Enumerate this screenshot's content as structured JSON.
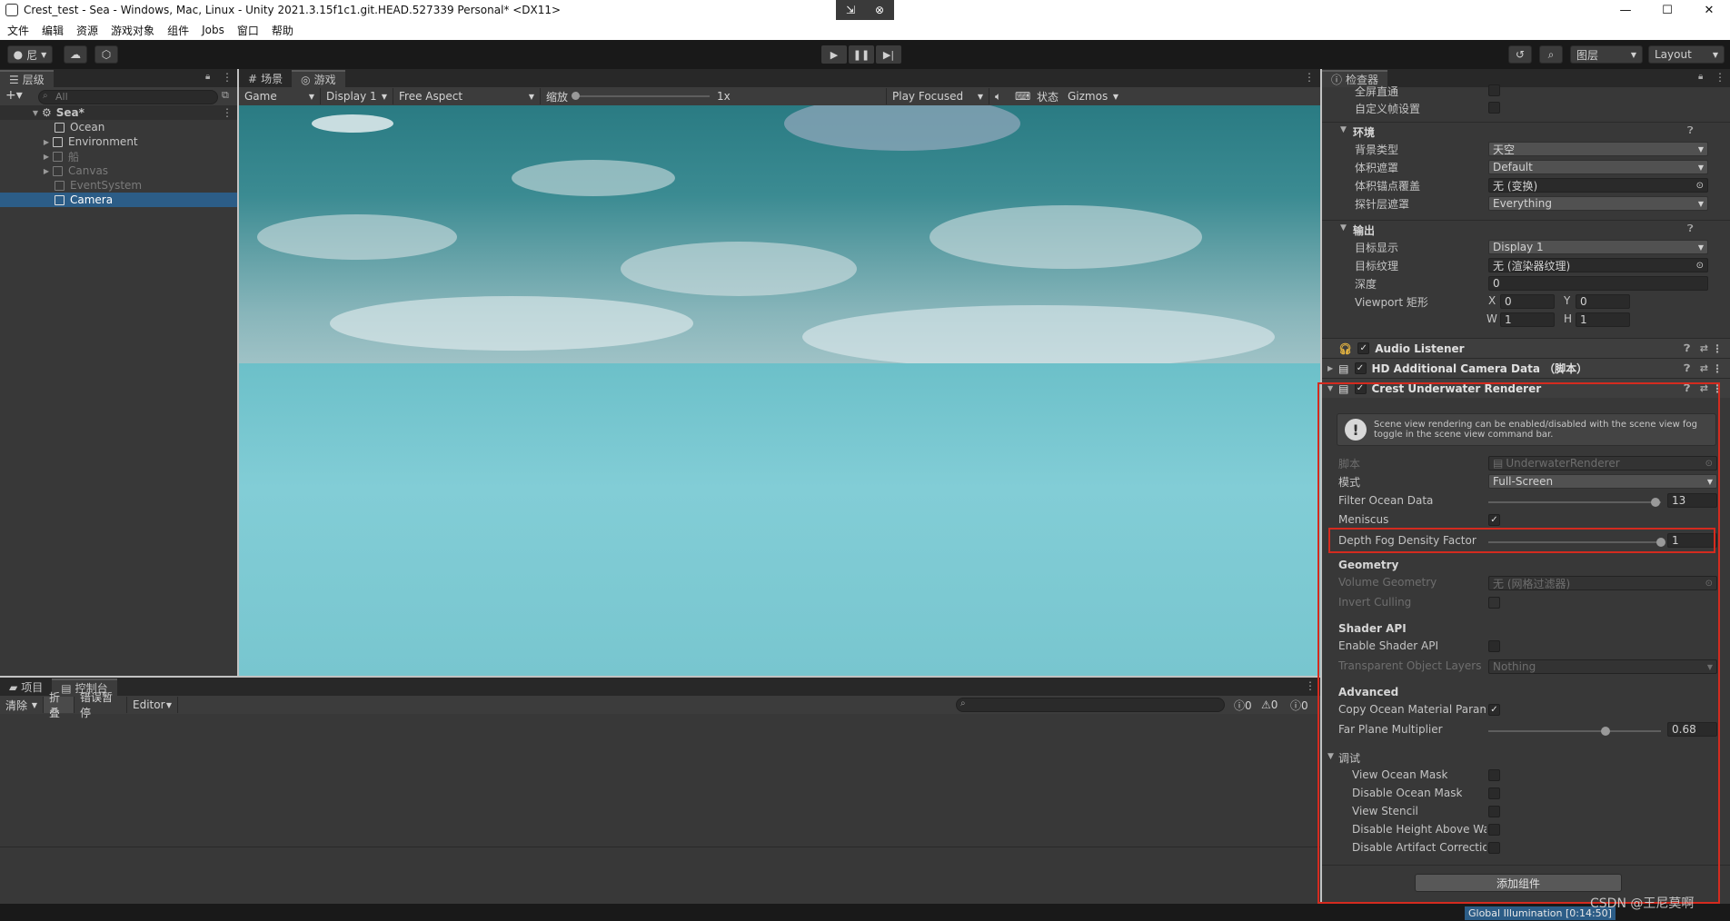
{
  "window": {
    "title": "Crest_test - Sea - Windows, Mac, Linux - Unity 2021.3.15f1c1.git.HEAD.527339 Personal* <DX11>",
    "minimize": "—",
    "maximize": "☐",
    "close": "✕"
  },
  "menu": [
    "文件",
    "编辑",
    "资源",
    "游戏对象",
    "组件",
    "Jobs",
    "窗口",
    "帮助"
  ],
  "toolbar": {
    "account": "尼",
    "layers": "图层",
    "layout": "Layout"
  },
  "hierarchy": {
    "tab": "层级",
    "search_placeholder": "All",
    "scene": "Sea*",
    "items": [
      {
        "label": "Ocean"
      },
      {
        "label": "Environment"
      },
      {
        "label": "船"
      },
      {
        "label": "Canvas"
      },
      {
        "label": "EventSystem"
      },
      {
        "label": "Camera"
      }
    ]
  },
  "game_view": {
    "tab_scene": "场景",
    "tab_game": "游戏",
    "mode": "Game",
    "display": "Display 1",
    "aspect": "Free Aspect",
    "scale_label": "缩放",
    "scale_value": "1x",
    "play_mode": "Play Focused",
    "stats": "状态",
    "gizmos": "Gizmos"
  },
  "console": {
    "tab_project": "项目",
    "tab_console": "控制台",
    "clear": "清除",
    "collapse": "折叠",
    "error_pause": "错误暂停",
    "editor": "Editor",
    "count_info": "0",
    "count_warn": "0",
    "count_error": "0"
  },
  "inspector": {
    "tab": "检查器",
    "top_rows": [
      {
        "label": "全屏直通"
      },
      {
        "label": "自定义帧设置"
      }
    ],
    "env_header": "环境",
    "env_rows": [
      {
        "label": "背景类型",
        "value": "天空"
      },
      {
        "label": "体积遮罩",
        "value": "Default"
      },
      {
        "label": "体积锚点覆盖",
        "value": "无 (变换)"
      },
      {
        "label": "探针层遮罩",
        "value": "Everything"
      }
    ],
    "output_header": "输出",
    "output_rows": [
      {
        "label": "目标显示",
        "value": "Display 1"
      },
      {
        "label": "目标纹理",
        "value": "无 (渲染器纹理)"
      },
      {
        "label": "深度",
        "value": "0"
      }
    ],
    "viewport_label": "Viewport 矩形",
    "viewport": {
      "x_label": "X",
      "x": "0",
      "y_label": "Y",
      "y": "0",
      "w_label": "W",
      "w": "1",
      "h_label": "H",
      "h": "1"
    },
    "components": {
      "audio_listener": "Audio Listener",
      "hd_camera": "HD Additional Camera Data （脚本）",
      "crest": "Crest Underwater Renderer"
    },
    "help_text": "Scene view rendering can be enabled/disabled with the scene view fog toggle in the scene view command bar.",
    "script_label": "脚本",
    "script_value": "UnderwaterRenderer",
    "mode_label": "模式",
    "mode_value": "Full-Screen",
    "filter_label": "Filter Ocean Data",
    "filter_value": "13",
    "filter_fraction": 0.97,
    "meniscus_label": "Meniscus",
    "depth_fog_label": "Depth Fog Density Factor",
    "depth_fog_value": "1",
    "depth_fog_fraction": 1.0,
    "geometry_header": "Geometry",
    "volume_geometry_label": "Volume Geometry",
    "volume_geometry_value": "无 (网格过滤器)",
    "invert_culling_label": "Invert Culling",
    "shader_header": "Shader API",
    "enable_shader_label": "Enable Shader API",
    "transparent_label": "Transparent Object Layers",
    "transparent_value": "Nothing",
    "advanced_header": "Advanced",
    "copy_ocean_label": "Copy Ocean Material Param",
    "far_plane_label": "Far Plane Multiplier",
    "far_plane_value": "0.68",
    "far_plane_fraction": 0.68,
    "debug_header": "调试",
    "debug_rows": [
      {
        "label": "View Ocean Mask"
      },
      {
        "label": "Disable Ocean Mask"
      },
      {
        "label": "View Stencil"
      },
      {
        "label": "Disable Height Above Wa"
      },
      {
        "label": "Disable Artifact Correctio"
      }
    ],
    "add_component": "添加组件"
  },
  "status": {
    "gi": "Global Illumination [0:14:50]",
    "watermark": "CSDN @王尼莫啊"
  },
  "colors": {
    "selection": "#2c5d87",
    "highlight_box": "#d42b1f"
  }
}
